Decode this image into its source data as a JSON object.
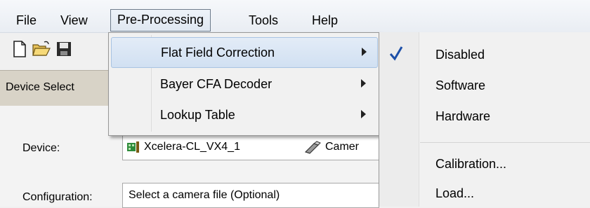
{
  "menubar": {
    "items": [
      "File",
      "View",
      "Pre-Processing",
      "Tools",
      "Help"
    ]
  },
  "toolbar": {
    "icons": [
      "new-file-icon",
      "open-folder-icon",
      "save-icon"
    ]
  },
  "panel": {
    "tab_label": "Device Select",
    "device_label": "Device:",
    "device_value": "Xcelera-CL_VX4_1",
    "camera_value": "Camer",
    "configuration_label": "Configuration:",
    "configuration_value": "Select a camera file (Optional)"
  },
  "dropdown": {
    "items": [
      {
        "label": "Flat Field Correction",
        "has_submenu": true
      },
      {
        "label": "Bayer CFA Decoder",
        "has_submenu": true
      },
      {
        "label": "Lookup Table",
        "has_submenu": true
      }
    ]
  },
  "submenu": {
    "items": [
      {
        "label": "Disabled",
        "checked": true
      },
      {
        "label": "Software",
        "checked": false
      },
      {
        "label": "Hardware",
        "checked": false
      },
      {
        "label": "Calibration...",
        "checked": false
      },
      {
        "label": "Load...",
        "checked": false
      }
    ]
  },
  "colors": {
    "highlight": "#d1e0f2",
    "check": "#1c4fa8",
    "board_green": "#2e8b3a"
  }
}
